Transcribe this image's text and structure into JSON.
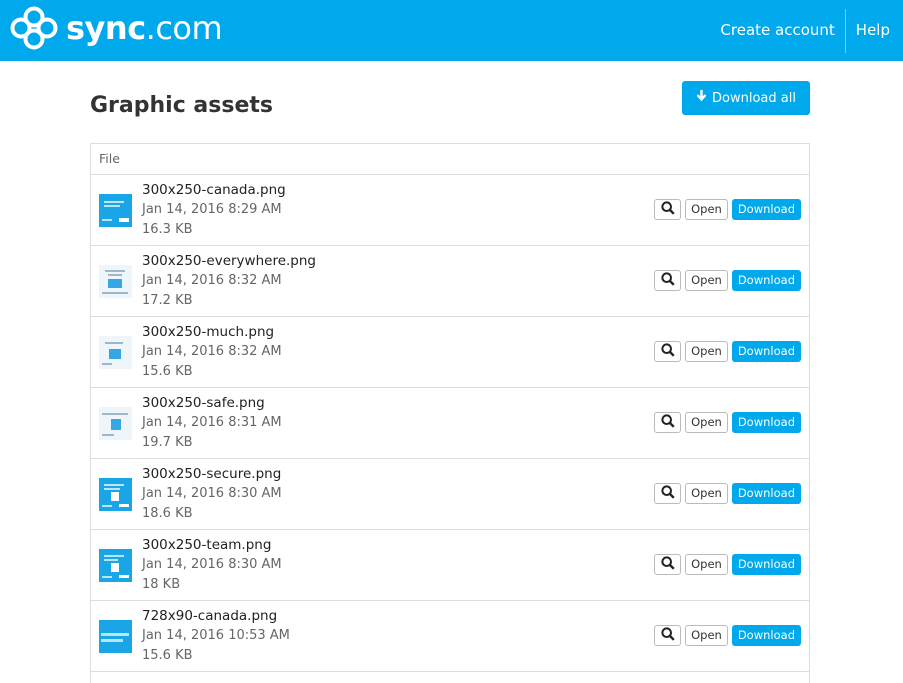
{
  "header": {
    "logo_text_bold": "sync",
    "logo_text_rest": ".com",
    "create_account": "Create account",
    "help": "Help"
  },
  "page": {
    "title": "Graphic assets",
    "download_all": "Download all"
  },
  "table": {
    "column": "File",
    "rows": [
      {
        "name": "300x250-canada.png",
        "date": "Jan 14, 2016 8:29 AM",
        "size": "16.3 KB"
      },
      {
        "name": "300x250-everywhere.png",
        "date": "Jan 14, 2016 8:32 AM",
        "size": "17.2 KB"
      },
      {
        "name": "300x250-much.png",
        "date": "Jan 14, 2016 8:32 AM",
        "size": "15.6 KB"
      },
      {
        "name": "300x250-safe.png",
        "date": "Jan 14, 2016 8:31 AM",
        "size": "19.7 KB"
      },
      {
        "name": "300x250-secure.png",
        "date": "Jan 14, 2016 8:30 AM",
        "size": "18.6 KB"
      },
      {
        "name": "300x250-team.png",
        "date": "Jan 14, 2016 8:30 AM",
        "size": "18 KB"
      },
      {
        "name": "728x90-canada.png",
        "date": "Jan 14, 2016 10:53 AM",
        "size": "15.6 KB"
      }
    ],
    "open_label": "Open",
    "download_label": "Download"
  },
  "colors": {
    "brand": "#00a8ec",
    "border": "#dddddd"
  },
  "icons": {
    "logo": "sync-logo-icon",
    "download_all": "arrow-down-icon",
    "preview": "search-icon"
  }
}
